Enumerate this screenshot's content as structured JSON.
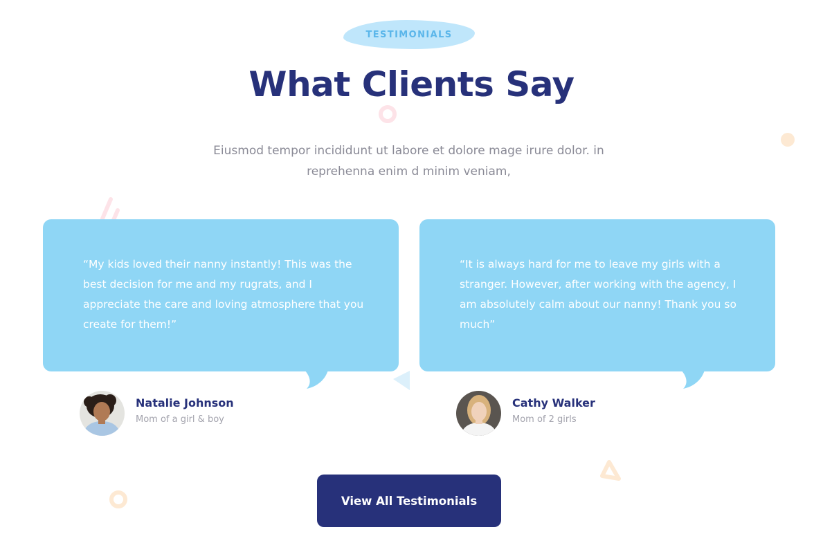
{
  "section": {
    "badge_label": "TESTIMONIALS",
    "title": "What Clients Say",
    "intro": "Eiusmod tempor incididunt ut labore et dolore mage irure dolor. in reprehenna enim d minim veniam,"
  },
  "testimonials": [
    {
      "quote": "“My kids loved their nanny instantly! This was the best decision for me and my rugrats, and I appreciate the care and loving atmosphere that you create for them!”",
      "name": "Natalie Johnson",
      "role": "Mom of a girl & boy",
      "avatar_icon": "woman-curly-hair-avatar"
    },
    {
      "quote": "“It is always hard for me to leave my girls with a stranger. However, after working with the agency, I am absolutely calm about our nanny! Thank you so much”",
      "name": "Cathy Walker",
      "role": "Mom of 2 girls",
      "avatar_icon": "woman-blonde-hair-avatar"
    }
  ],
  "cta": {
    "label": "View All Testimonials"
  },
  "colors": {
    "navy": "#27317a",
    "card_blue": "#8fd6f5",
    "badge_bg": "#bfe6fb",
    "badge_text": "#5bb6ea",
    "muted_text": "#8a8a96"
  }
}
